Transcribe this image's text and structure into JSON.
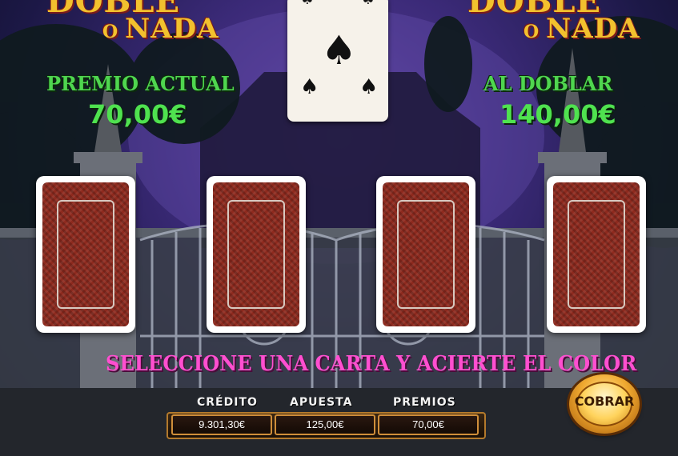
{
  "game": {
    "title_word": "DOBLE",
    "subtitle_prefix": "O",
    "subtitle_word": "NADA"
  },
  "premio_actual": {
    "label": "PREMIO ACTUAL",
    "value": "70,00€"
  },
  "al_doblar": {
    "label": "AL DOBLAR",
    "value": "140,00€"
  },
  "dealer_card": {
    "rank": "5",
    "suit": "♠",
    "suit_name": "spades"
  },
  "instruction": "SELECCIONE UNA CARTA Y ACIERTE EL COLOR",
  "stats": {
    "credito_label": "CRÉDITO",
    "credito_value": "9.301,30€",
    "apuesta_label": "APUESTA",
    "apuesta_value": "125,00€",
    "premios_label": "PREMIOS",
    "premios_value": "70,00€"
  },
  "buttons": {
    "cobrar": "COBRAR"
  },
  "colors": {
    "title_gold": "#f2c12e",
    "prize_green": "#4fe24f",
    "instruction_pink": "#ff4fd0",
    "card_back_red": "#8e2a1e"
  }
}
